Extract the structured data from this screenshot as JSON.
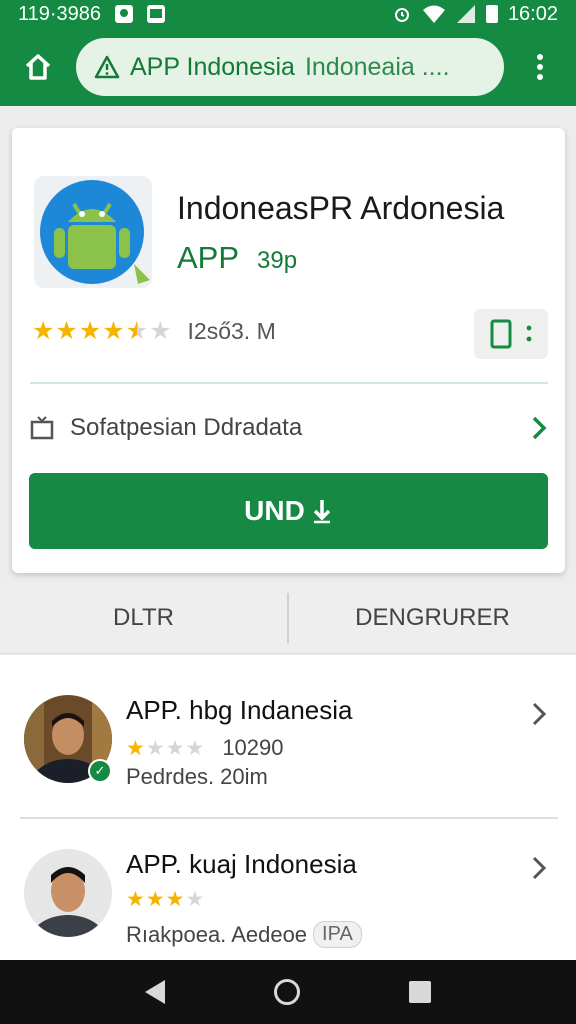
{
  "status_bar": {
    "time_left": "119·3986",
    "time_right": "16:02"
  },
  "app_bar": {
    "url_title": "APP Indonesia",
    "url_sub": "Indoneaia ...."
  },
  "card": {
    "app_name": "IndoneasPR Ardonesia",
    "app_label": "APP",
    "app_size": "39p",
    "rating": 4.5,
    "reviews": "I2ső3. M",
    "info_text": "Sofatpesian Ddradata",
    "install_label": "UND"
  },
  "tabs": [
    {
      "label": "DLTR"
    },
    {
      "label": "DENGRURER"
    }
  ],
  "list": [
    {
      "title": "APP. hbg Indanesia",
      "rating": 1,
      "count": "10290",
      "sub": "Pedrdes. 20im"
    },
    {
      "title": "APP. kuaj Indonesia",
      "rating": 3,
      "sub": "Rıakpoea. Aedeoe",
      "badge": "IPA"
    }
  ],
  "colors": {
    "brand_green": "#158a42",
    "star": "#f4b400"
  }
}
